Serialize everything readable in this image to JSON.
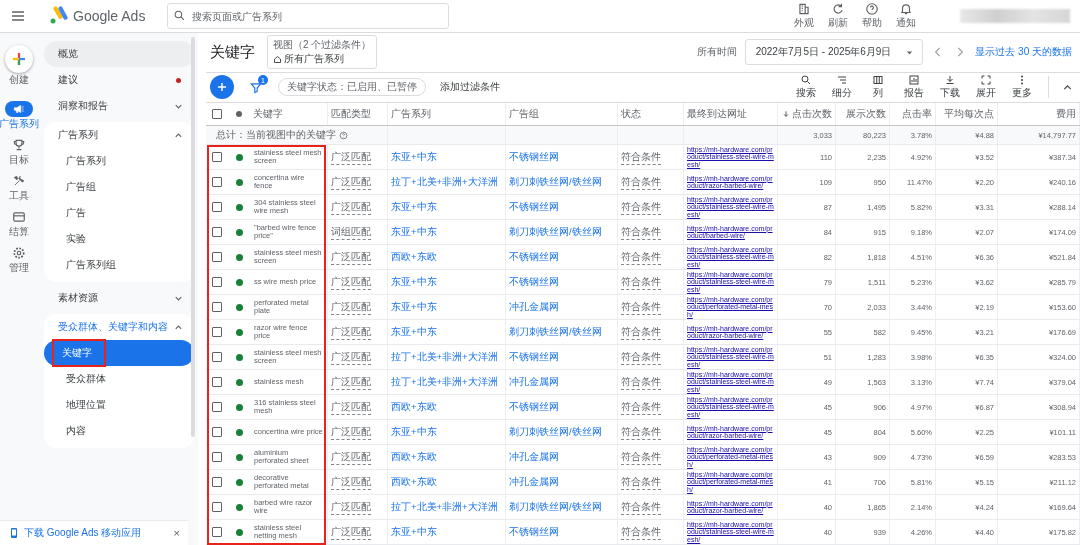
{
  "app": {
    "name": "Google Ads"
  },
  "search": {
    "placeholder": "搜索页面或广告系列"
  },
  "header_actions": [
    {
      "label": "外观"
    },
    {
      "label": "刷新"
    },
    {
      "label": "帮助"
    },
    {
      "label": "通知"
    }
  ],
  "rail": [
    {
      "label": "创建",
      "selected": false
    },
    {
      "label": "广告系列",
      "selected": true
    },
    {
      "label": "目标",
      "selected": false
    },
    {
      "label": "工具",
      "selected": false
    },
    {
      "label": "结算",
      "selected": false
    },
    {
      "label": "管理",
      "selected": false
    }
  ],
  "nav": [
    {
      "label": "概览",
      "hovered": true
    },
    {
      "label": "建议",
      "alert": true,
      "hovered": false
    },
    {
      "label": "洞察和报告",
      "expanded": false,
      "hovered": false
    },
    {
      "label": "广告系列",
      "expanded": true,
      "children": [
        {
          "label": "广告系列",
          "selected": false,
          "highlighted": false
        },
        {
          "label": "广告组",
          "selected": false,
          "highlighted": false
        },
        {
          "label": "广告",
          "selected": false,
          "highlighted": false
        },
        {
          "label": "实验",
          "selected": false,
          "highlighted": false
        },
        {
          "label": "广告系列组",
          "selected": false,
          "highlighted": false
        }
      ]
    },
    {
      "label": "素材资源",
      "expanded": false,
      "hovered": false
    },
    {
      "label": "受众群体、关键字和内容",
      "expanded": true,
      "children": [
        {
          "label": "关键字",
          "selected": true,
          "highlighted": true
        },
        {
          "label": "受众群体",
          "selected": false,
          "highlighted": false
        },
        {
          "label": "地理位置",
          "selected": false,
          "highlighted": false
        },
        {
          "label": "内容",
          "selected": false,
          "highlighted": false
        }
      ]
    }
  ],
  "app_banner": {
    "text": "下载 Google Ads 移动应用",
    "close": "×"
  },
  "page": {
    "title": "关键字",
    "view_label": "视图（2 个过滤条件）",
    "view_value": "所有广告系列",
    "range_label": "所有时间",
    "date_range": "2022年7月5日 - 2025年6月9日",
    "recent_link": "显示过去 30 天的数据"
  },
  "toolbar": {
    "filter_count": "1",
    "filter_chip": "关键字状态：已启用、已暂停",
    "add_filter": "添加过滤条件",
    "tools": [
      {
        "label": "搜索"
      },
      {
        "label": "细分"
      },
      {
        "label": "列"
      },
      {
        "label": "报告"
      },
      {
        "label": "下载"
      },
      {
        "label": "展开"
      },
      {
        "label": "更多"
      }
    ]
  },
  "table": {
    "keyword_column_highlighted": true,
    "all_checked": false,
    "columns": [
      {
        "label": "关键字",
        "sorted": false
      },
      {
        "label": "匹配类型",
        "sorted": false
      },
      {
        "label": "广告系列",
        "sorted": false
      },
      {
        "label": "广告组",
        "sorted": false
      },
      {
        "label": "状态",
        "sorted": false
      },
      {
        "label": "最终到达网址",
        "sorted": false
      },
      {
        "label": "点击次数",
        "sorted": true
      },
      {
        "label": "展示次数",
        "sorted": false
      },
      {
        "label": "点击率",
        "sorted": false
      },
      {
        "label": "平均每次点",
        "sorted": false
      },
      {
        "label": "费用",
        "sorted": false
      }
    ],
    "total": {
      "label": "总计：当前视图中的关键字",
      "clicks": "3,033",
      "impressions": "80,223",
      "ctr": "3.78%",
      "avg_cpc": "¥4.88",
      "cost": "¥14,797.77"
    },
    "rows": [
      {
        "checked": false,
        "enabled": true,
        "keyword": "stainless steel mesh screen",
        "match_type": "广泛匹配",
        "campaign": "东亚+中东",
        "ad_group": "不锈钢丝网",
        "status": "符合条件",
        "final_url": "https://mh-hardware.com/product/stainless-steel-wire-mesh/",
        "clicks": "110",
        "impressions": "2,235",
        "ctr": "4.92%",
        "avg_cpc": "¥3.52",
        "cost": "¥387.34"
      },
      {
        "checked": false,
        "enabled": true,
        "keyword": "concertina wire fence",
        "match_type": "广泛匹配",
        "campaign": "拉丁+北美+非洲+大洋洲",
        "ad_group": "剃刀刺铁丝网/铁丝网",
        "status": "符合条件",
        "final_url": "https://mh-hardware.com/product/razor-barbed-wire/",
        "clicks": "109",
        "impressions": "950",
        "ctr": "11.47%",
        "avg_cpc": "¥2.20",
        "cost": "¥240.16"
      },
      {
        "checked": false,
        "enabled": true,
        "keyword": "304 stainless steel wire mesh",
        "match_type": "广泛匹配",
        "campaign": "东亚+中东",
        "ad_group": "不锈钢丝网",
        "status": "符合条件",
        "final_url": "https://mh-hardware.com/product/stainless-steel-wire-mesh/",
        "clicks": "87",
        "impressions": "1,495",
        "ctr": "5.82%",
        "avg_cpc": "¥3.31",
        "cost": "¥288.14"
      },
      {
        "checked": false,
        "enabled": true,
        "keyword": "\"barbed wire fence price\"",
        "match_type": "词组匹配",
        "campaign": "东亚+中东",
        "ad_group": "剃刀刺铁丝网/铁丝网",
        "status": "符合条件",
        "final_url": "https://mh-hardware.com/product/barbed-wire/",
        "clicks": "84",
        "impressions": "915",
        "ctr": "9.18%",
        "avg_cpc": "¥2.07",
        "cost": "¥174.09"
      },
      {
        "checked": false,
        "enabled": true,
        "keyword": "stainless steel mesh screen",
        "match_type": "广泛匹配",
        "campaign": "西欧+东欧",
        "ad_group": "不锈钢丝网",
        "status": "符合条件",
        "final_url": "https://mh-hardware.com/product/stainless-steel-wire-mesh/",
        "clicks": "82",
        "impressions": "1,818",
        "ctr": "4.51%",
        "avg_cpc": "¥6.36",
        "cost": "¥521.84"
      },
      {
        "checked": false,
        "enabled": true,
        "keyword": "ss wire mesh price",
        "match_type": "广泛匹配",
        "campaign": "东亚+中东",
        "ad_group": "不锈钢丝网",
        "status": "符合条件",
        "final_url": "https://mh-hardware.com/product/stainless-steel-wire-mesh/",
        "clicks": "79",
        "impressions": "1,511",
        "ctr": "5.23%",
        "avg_cpc": "¥3.62",
        "cost": "¥285.79"
      },
      {
        "checked": false,
        "enabled": true,
        "keyword": "perforated metal plate",
        "match_type": "广泛匹配",
        "campaign": "东亚+中东",
        "ad_group": "冲孔金属网",
        "status": "符合条件",
        "final_url": "https://mh-hardware.com/product/perforated-metal-mesh/",
        "clicks": "70",
        "impressions": "2,033",
        "ctr": "3.44%",
        "avg_cpc": "¥2.19",
        "cost": "¥153.60"
      },
      {
        "checked": false,
        "enabled": true,
        "keyword": "razor wire fence price",
        "match_type": "广泛匹配",
        "campaign": "东亚+中东",
        "ad_group": "剃刀刺铁丝网/铁丝网",
        "status": "符合条件",
        "final_url": "https://mh-hardware.com/product/razor-barbed-wire/",
        "clicks": "55",
        "impressions": "582",
        "ctr": "9.45%",
        "avg_cpc": "¥3.21",
        "cost": "¥176.69"
      },
      {
        "checked": false,
        "enabled": true,
        "keyword": "stainless steel mesh screen",
        "match_type": "广泛匹配",
        "campaign": "拉丁+北美+非洲+大洋洲",
        "ad_group": "不锈钢丝网",
        "status": "符合条件",
        "final_url": "https://mh-hardware.com/product/stainless-steel-wire-mesh/",
        "clicks": "51",
        "impressions": "1,283",
        "ctr": "3.98%",
        "avg_cpc": "¥6.35",
        "cost": "¥324.00"
      },
      {
        "checked": false,
        "enabled": true,
        "keyword": "stainless mesh",
        "match_type": "广泛匹配",
        "campaign": "拉丁+北美+非洲+大洋洲",
        "ad_group": "冲孔金属网",
        "status": "符合条件",
        "final_url": "https://mh-hardware.com/product/stainless-steel-wire-mesh/",
        "clicks": "49",
        "impressions": "1,563",
        "ctr": "3.13%",
        "avg_cpc": "¥7.74",
        "cost": "¥379.04"
      },
      {
        "checked": false,
        "enabled": true,
        "keyword": "316 stainless steel mesh",
        "match_type": "广泛匹配",
        "campaign": "西欧+东欧",
        "ad_group": "不锈钢丝网",
        "status": "符合条件",
        "final_url": "https://mh-hardware.com/product/stainless-steel-wire-mesh/",
        "clicks": "45",
        "impressions": "906",
        "ctr": "4.97%",
        "avg_cpc": "¥6.87",
        "cost": "¥308.94"
      },
      {
        "checked": false,
        "enabled": true,
        "keyword": "concertina wire price",
        "match_type": "广泛匹配",
        "campaign": "东亚+中东",
        "ad_group": "剃刀刺铁丝网/铁丝网",
        "status": "符合条件",
        "final_url": "https://mh-hardware.com/product/razor-barbed-wire/",
        "clicks": "45",
        "impressions": "804",
        "ctr": "5.60%",
        "avg_cpc": "¥2.25",
        "cost": "¥101.11"
      },
      {
        "checked": false,
        "enabled": true,
        "keyword": "aluminium perforated sheet",
        "match_type": "广泛匹配",
        "campaign": "西欧+东欧",
        "ad_group": "冲孔金属网",
        "status": "符合条件",
        "final_url": "https://mh-hardware.com/product/perforated-metal-mesh/",
        "clicks": "43",
        "impressions": "909",
        "ctr": "4.73%",
        "avg_cpc": "¥6.59",
        "cost": "¥283.53"
      },
      {
        "checked": false,
        "enabled": true,
        "keyword": "decorative perforated metal",
        "match_type": "广泛匹配",
        "campaign": "西欧+东欧",
        "ad_group": "冲孔金属网",
        "status": "符合条件",
        "final_url": "https://mh-hardware.com/product/perforated-metal-mesh/",
        "clicks": "41",
        "impressions": "706",
        "ctr": "5.81%",
        "avg_cpc": "¥5.15",
        "cost": "¥211.12"
      },
      {
        "checked": false,
        "enabled": true,
        "keyword": "barbed wire razor wire",
        "match_type": "广泛匹配",
        "campaign": "拉丁+北美+非洲+大洋洲",
        "ad_group": "剃刀刺铁丝网/铁丝网",
        "status": "符合条件",
        "final_url": "https://mh-hardware.com/product/razor-barbed-wire/",
        "clicks": "40",
        "impressions": "1,865",
        "ctr": "2.14%",
        "avg_cpc": "¥4.24",
        "cost": "¥169.64"
      },
      {
        "checked": false,
        "enabled": true,
        "keyword": "stainless steel netting mesh",
        "match_type": "广泛匹配",
        "campaign": "东亚+中东",
        "ad_group": "不锈钢丝网",
        "status": "符合条件",
        "final_url": "https://mh-hardware.com/product/stainless-steel-wire-mesh/",
        "clicks": "40",
        "impressions": "939",
        "ctr": "4.26%",
        "avg_cpc": "¥4.40",
        "cost": "¥175.82"
      }
    ]
  }
}
